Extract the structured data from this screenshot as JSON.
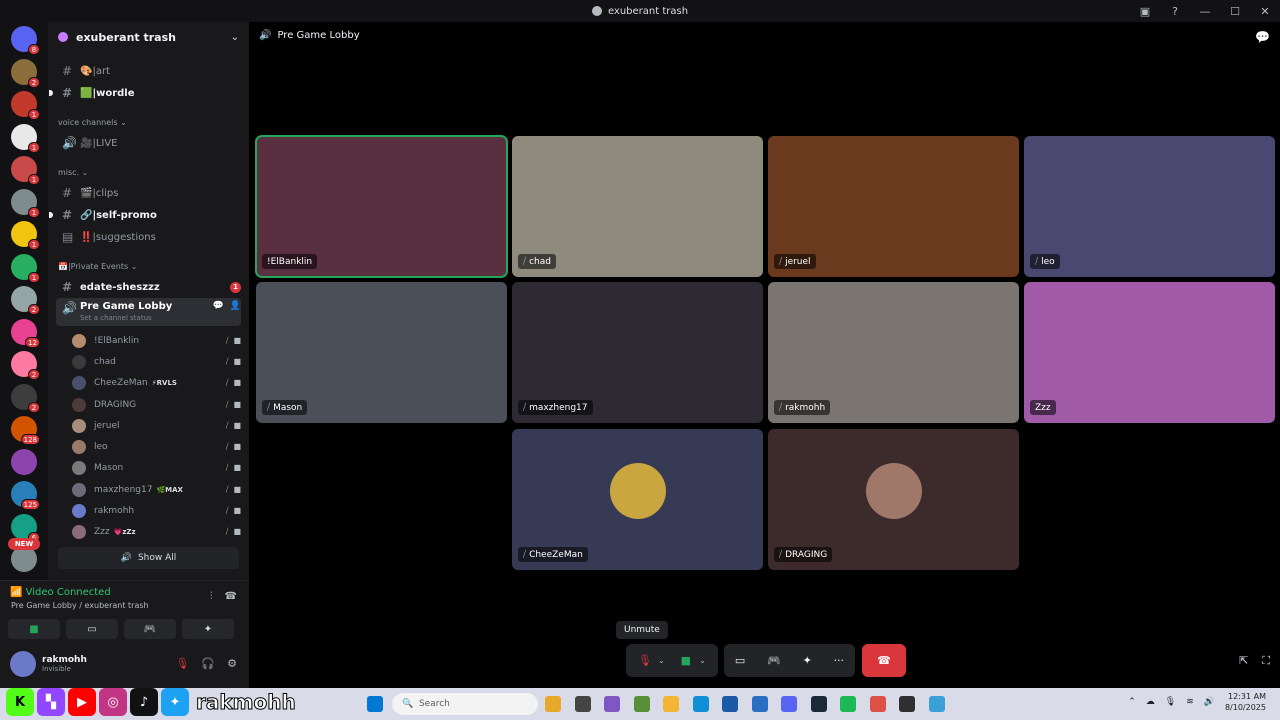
{
  "window": {
    "title": "exuberant trash"
  },
  "server_badges": [
    {
      "badge": "8",
      "color": "#5865f2"
    },
    {
      "badge": "2",
      "color": "#8a6d3b"
    },
    {
      "badge": "1",
      "color": "#c0392b"
    },
    {
      "badge": "1",
      "color": "#e8e8e8"
    },
    {
      "badge": "1",
      "color": "#c94a4a"
    },
    {
      "badge": "1",
      "color": "#7f8c8d"
    },
    {
      "badge": "1",
      "color": "#f1c40f"
    },
    {
      "badge": "1",
      "color": "#27ae60"
    },
    {
      "badge": "2",
      "color": "#95a5a6"
    },
    {
      "badge": "12",
      "color": "#e84393"
    },
    {
      "badge": "2",
      "color": "#ff7aa2"
    },
    {
      "badge": "2",
      "color": "#3d3d3d"
    },
    {
      "badge": "128",
      "color": "#d35400"
    },
    {
      "badge": "",
      "color": "#8e44ad"
    },
    {
      "badge": "125",
      "color": "#2980b9"
    },
    {
      "badge": "6",
      "color": "#16a085"
    },
    {
      "badge": "",
      "color": "#7f8c8d"
    }
  ],
  "new_label": "NEW",
  "sidebar": {
    "guild_name": "exuberant trash",
    "channels_top": [
      {
        "name": "🎨|art"
      },
      {
        "name": "🟩|wordle"
      }
    ],
    "cat_voice": "voice channels",
    "live": "🎥|LIVE",
    "cat_misc": "misc.",
    "misc_channels": [
      {
        "name": "🎬|clips"
      },
      {
        "name": "🔗|self-promo"
      },
      {
        "name": "‼️|suggestions"
      }
    ],
    "cat_events": "📅|Private Events",
    "edate": "edate-sheszzz",
    "edate_badge": "1",
    "current_channel": "Pre Game Lobby",
    "channel_status": "Set a channel status",
    "users": [
      {
        "name": "!ElBanklin",
        "tag": "",
        "color": "#b38b6d"
      },
      {
        "name": "chad",
        "tag": "",
        "color": "#3a3a3a"
      },
      {
        "name": "CheeZeMan",
        "tag": "⚡RVLS",
        "color": "#4a4f6b"
      },
      {
        "name": "DRAGING",
        "tag": "",
        "color": "#4f3a3a"
      },
      {
        "name": "jeruel",
        "tag": "",
        "color": "#a88d7a"
      },
      {
        "name": "leo",
        "tag": "",
        "color": "#9a7b6b"
      },
      {
        "name": "Mason",
        "tag": "",
        "color": "#7a7a7a"
      },
      {
        "name": "maxzheng17",
        "tag": "🌿MAX",
        "color": "#6b6b7a"
      },
      {
        "name": "rakmohh",
        "tag": "",
        "color": "#6a7ac8"
      },
      {
        "name": "Zzz",
        "tag": "💗zZz",
        "color": "#8a6b7a"
      }
    ],
    "show_all": "Show All"
  },
  "voice": {
    "status": "Video Connected",
    "location": "Pre Game Lobby / exuberant trash"
  },
  "user": {
    "name": "rakmohh",
    "status": "Invisible"
  },
  "main": {
    "channel": "Pre Game Lobby",
    "tiles": [
      {
        "name": "!ElBanklin",
        "color": "#5a3040",
        "muted": false
      },
      {
        "name": "chad",
        "color": "#8f8a7e",
        "muted": true
      },
      {
        "name": "jeruel",
        "color": "#6b3a1e",
        "muted": true
      },
      {
        "name": "leo",
        "color": "#4a4870",
        "muted": true
      },
      {
        "name": "Mason",
        "color": "#4a4f58",
        "muted": true
      },
      {
        "name": "maxzheng17",
        "color": "#2e2a34",
        "muted": true
      },
      {
        "name": "rakmohh",
        "color": "#7a7570",
        "muted": true
      },
      {
        "name": "Zzz",
        "color": "#a05aa8",
        "muted": false
      },
      {
        "name": "CheeZeMan",
        "color": "#373a55",
        "muted": true
      },
      {
        "name": "DRAGING",
        "color": "#3d2a2a",
        "muted": true
      }
    ],
    "tooltip": "Unmute"
  },
  "taskbar": {
    "search_placeholder": "Search",
    "time": "12:31 AM",
    "date": "8/10/2025",
    "overlay_text": "rakmohh"
  }
}
